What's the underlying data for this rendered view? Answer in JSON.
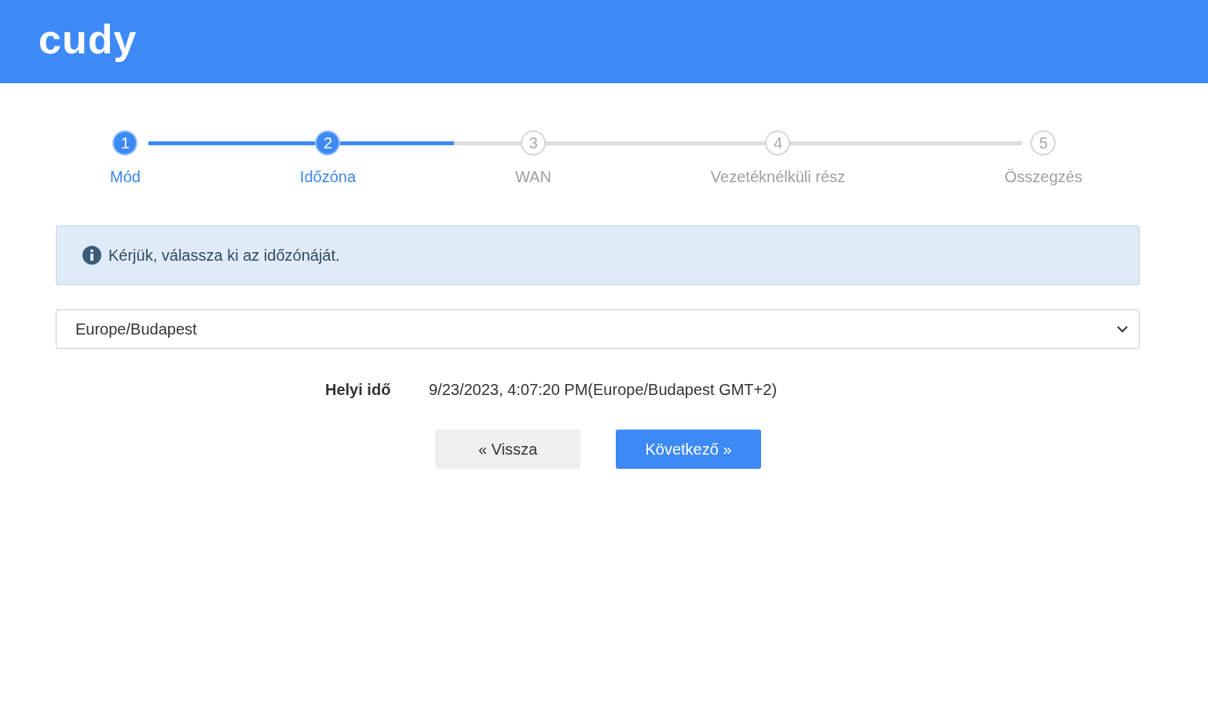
{
  "header": {
    "logo": "cudy"
  },
  "stepper": {
    "level": 0.35,
    "steps": [
      {
        "number": "1",
        "label": "Mód",
        "done": true
      },
      {
        "number": "2",
        "label": "Időzóna",
        "done": true
      },
      {
        "number": "3",
        "label": "WAN",
        "done": false
      },
      {
        "number": "4",
        "label": "Vezetéknélküli rész",
        "done": false
      },
      {
        "number": "5",
        "label": "Összegzés",
        "done": false
      }
    ]
  },
  "alert": {
    "text": "Kérjük, válassza ki az időzónáját."
  },
  "timezone_select": {
    "value": "Europe/Budapest"
  },
  "local_time": {
    "label": "Helyi idő",
    "value": "9/23/2023, 4:07:20 PM(Europe/Budapest GMT+2)"
  },
  "buttons": [
    {
      "label": "« Vissza",
      "kind": "secondary"
    },
    {
      "label": "Következő »",
      "kind": "primary"
    }
  ]
}
